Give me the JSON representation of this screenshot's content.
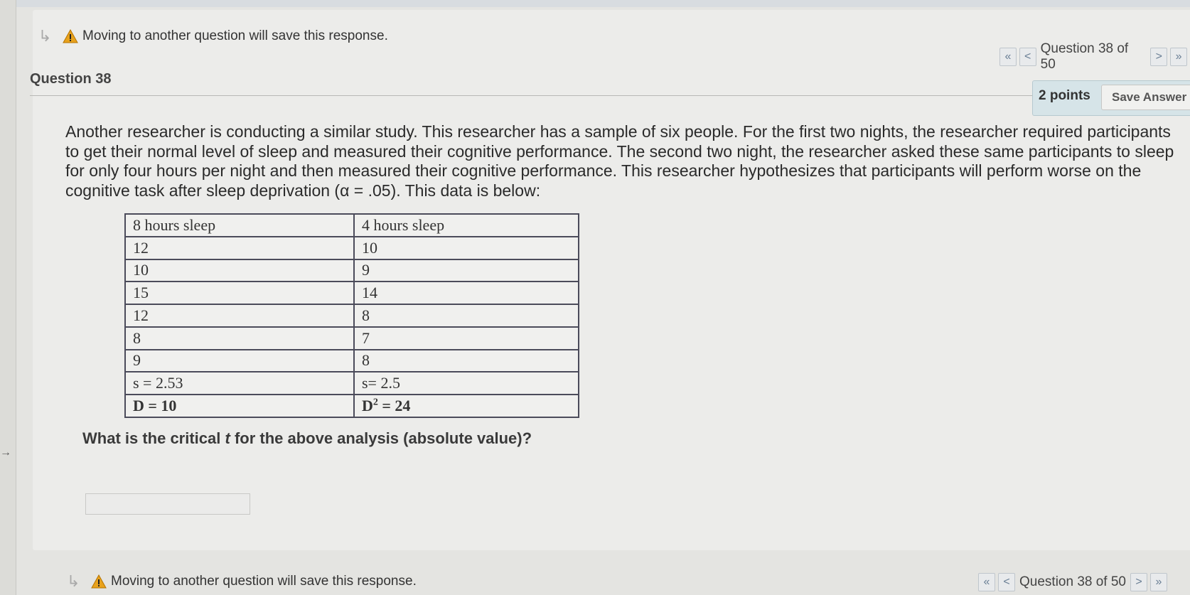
{
  "warning": {
    "text": "Moving to another question will save this response."
  },
  "pager": {
    "label": "Question 38 of 50",
    "first": "«",
    "prev": "<",
    "next": ">",
    "last": "»"
  },
  "question": {
    "title": "Question 38",
    "points": "2 points",
    "save_label": "Save Answer",
    "prompt": "Another researcher is conducting a similar study.  This researcher has a sample of six people.  For the first two nights, the researcher required participants to get their normal level of sleep and measured their cognitive performance.  The second two night, the researcher asked these same participants to sleep for only four hours per night and then measured their cognitive performance.  This researcher hypothesizes that participants will perform worse on the cognitive task after sleep deprivation (α = .05).  This data is below:",
    "ask_prefix": "What is the critical ",
    "ask_var": "t",
    "ask_suffix": " for the above analysis (absolute value)?",
    "answer_value": ""
  },
  "table": {
    "headers": [
      "8 hours sleep",
      "4 hours sleep"
    ],
    "rows": [
      [
        "12",
        "10"
      ],
      [
        "10",
        "9"
      ],
      [
        "15",
        "14"
      ],
      [
        "12",
        "8"
      ],
      [
        "8",
        "7"
      ],
      [
        "9",
        "8"
      ],
      [
        "s = 2.53",
        "s= 2.5"
      ]
    ],
    "last_left": "D = 10",
    "last_right_base": "D",
    "last_right_sup": "2",
    "last_right_rest": " = 24"
  },
  "colors": {
    "warning": "#e8a21c",
    "points_bg": "#d6e4e8"
  }
}
